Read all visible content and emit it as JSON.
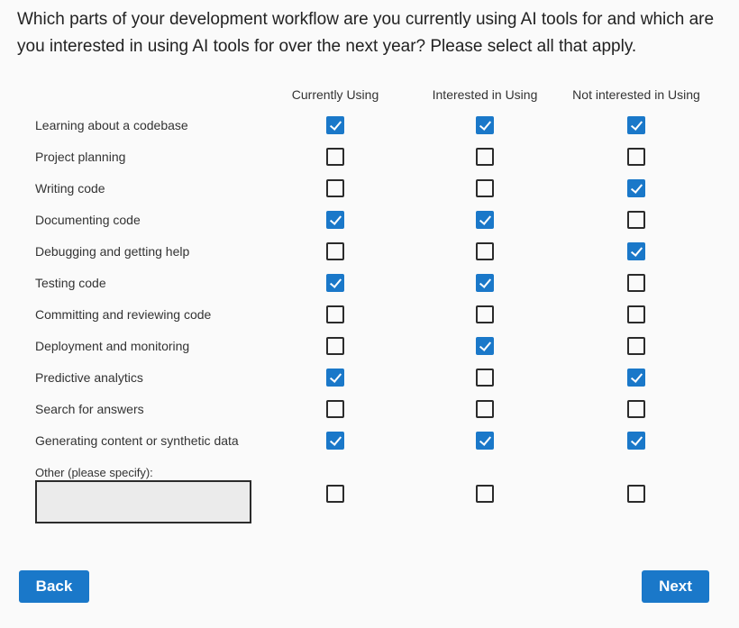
{
  "question": "Which parts of your development workflow are you currently using AI tools for and which are you interested in using AI tools for over the next year?  Please select all that apply.",
  "columns": [
    "Currently Using",
    "Interested in Using",
    "Not interested in Using"
  ],
  "rows": [
    {
      "label": "Learning about a codebase",
      "checked": [
        true,
        true,
        true
      ]
    },
    {
      "label": "Project planning",
      "checked": [
        false,
        false,
        false
      ]
    },
    {
      "label": "Writing code",
      "checked": [
        false,
        false,
        true
      ]
    },
    {
      "label": "Documenting code",
      "checked": [
        true,
        true,
        false
      ]
    },
    {
      "label": "Debugging and getting help",
      "checked": [
        false,
        false,
        true
      ]
    },
    {
      "label": "Testing code",
      "checked": [
        true,
        true,
        false
      ]
    },
    {
      "label": "Committing and reviewing code",
      "checked": [
        false,
        false,
        false
      ]
    },
    {
      "label": "Deployment and monitoring",
      "checked": [
        false,
        true,
        false
      ]
    },
    {
      "label": "Predictive analytics",
      "checked": [
        true,
        false,
        true
      ]
    },
    {
      "label": "Search for answers",
      "checked": [
        false,
        false,
        false
      ]
    },
    {
      "label": "Generating content or synthetic data",
      "checked": [
        true,
        true,
        true
      ]
    }
  ],
  "other": {
    "label": "Other (please specify):",
    "value": "",
    "checked": [
      false,
      false,
      false
    ]
  },
  "buttons": {
    "back": "Back",
    "next": "Next"
  },
  "colors": {
    "accent": "#1a78c9",
    "background": "#fafafa"
  }
}
